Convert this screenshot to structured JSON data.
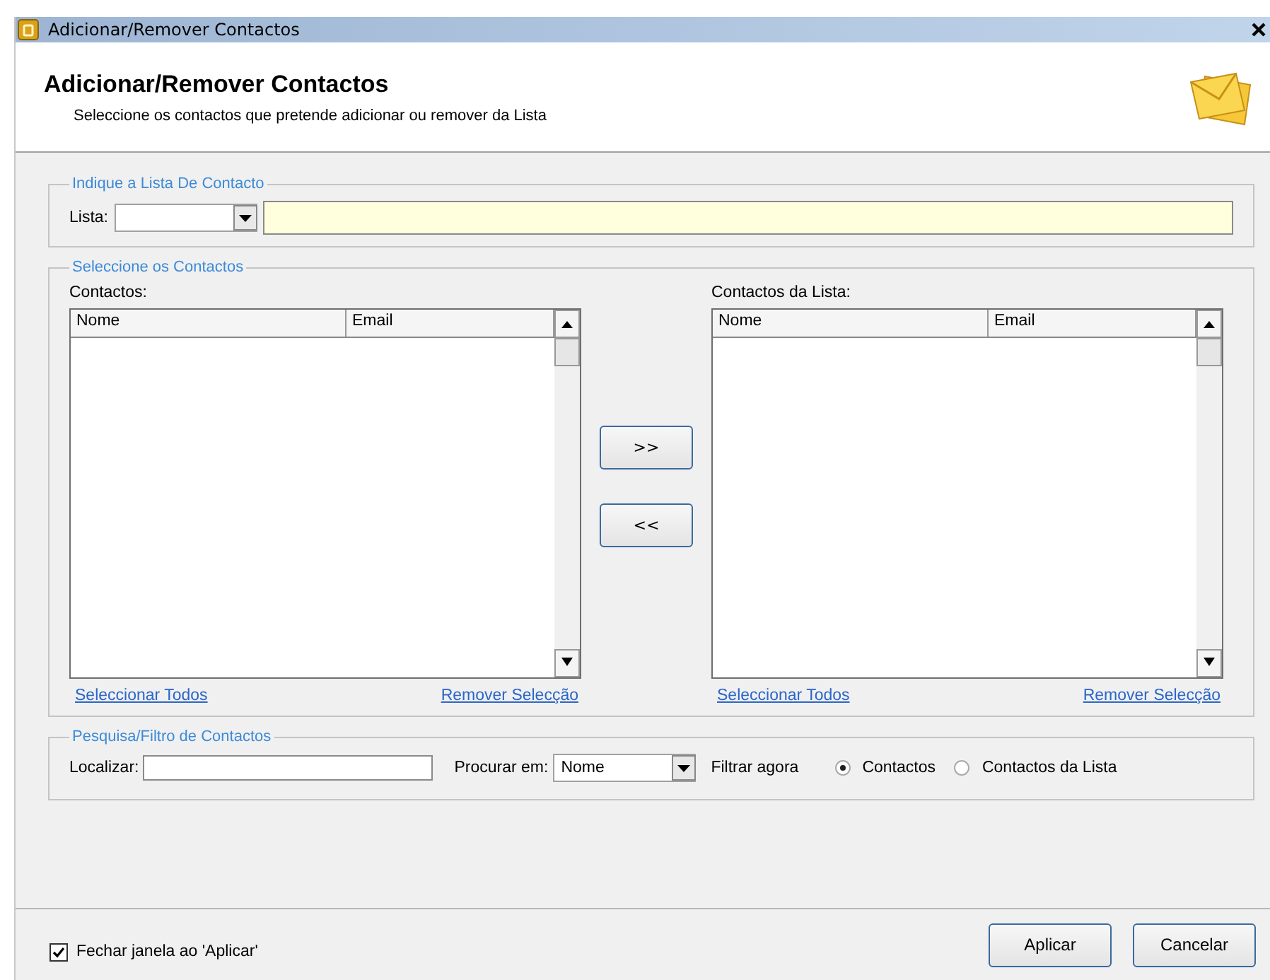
{
  "window": {
    "title": "Adicionar/Remover Contactos"
  },
  "header": {
    "title": "Adicionar/Remover Contactos",
    "subtitle": "Seleccione os contactos que pretende adicionar ou remover da Lista"
  },
  "list_group": {
    "legend": "Indique a Lista De Contacto",
    "label": "Lista:"
  },
  "contacts_group": {
    "legend": "Seleccione os Contactos",
    "panels": [
      {
        "label": "Contactos:",
        "columns": [
          "Nome",
          "Email"
        ],
        "links": [
          "Seleccionar Todos",
          "Remover Selecção"
        ]
      },
      {
        "label": "Contactos da Lista:",
        "columns": [
          "Nome",
          "Email"
        ],
        "links": [
          "Seleccionar Todos",
          "Remover Selecção"
        ]
      }
    ],
    "move_buttons": [
      ">>",
      "<<"
    ]
  },
  "search_group": {
    "legend": "Pesquisa/Filtro de Contactos",
    "find_label": "Localizar:",
    "search_in_label": "Procurar em:",
    "search_in_value": "Nome",
    "filter_link": "Filtrar agora",
    "radios": [
      {
        "label": "Contactos",
        "selected": true
      },
      {
        "label": "Contactos da Lista",
        "selected": false
      }
    ]
  },
  "close_on_apply": {
    "label": "Fechar janela ao 'Aplicar'",
    "checked": true
  },
  "buttons": [
    "Aplicar",
    "Cancelar"
  ]
}
